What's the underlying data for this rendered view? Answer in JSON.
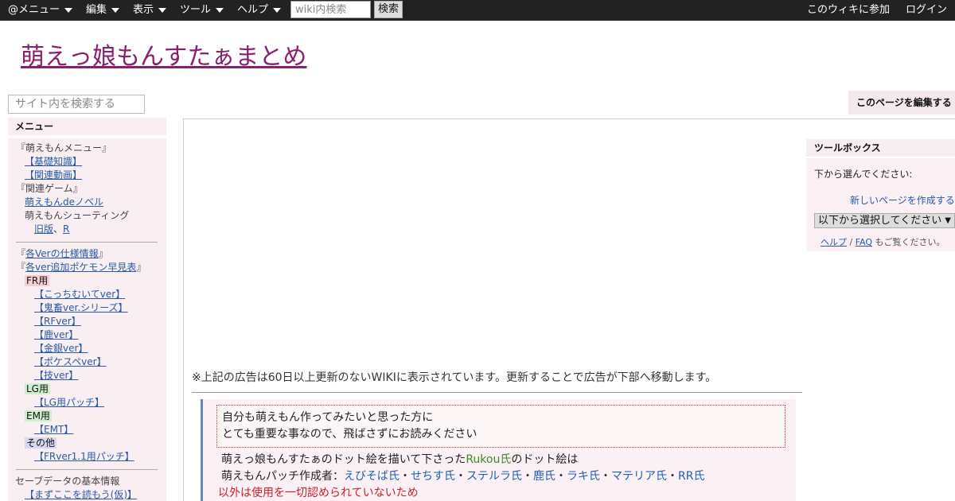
{
  "topbar": {
    "menus": [
      {
        "label": "@メニュー"
      },
      {
        "label": "編集"
      },
      {
        "label": "表示"
      },
      {
        "label": "ツール"
      },
      {
        "label": "ヘルプ"
      }
    ],
    "search_placeholder": "wiki内検索",
    "search_button": "検索",
    "join": "このウィキに参加",
    "login": "ログイン"
  },
  "site": {
    "title": "萌えっ娘もんすたぁまとめ",
    "search_placeholder": "サイト内を検索する",
    "edit_button": "このページを編集する"
  },
  "sidebar": {
    "heading": "メニュー",
    "items": [
      {
        "text": "『萌えもんメニュー』"
      },
      {
        "text": "【基礎知識】"
      },
      {
        "text": "【関連動画】"
      },
      {
        "text": "『関連ゲーム』"
      },
      {
        "text": "萌えもんdeノベル"
      },
      {
        "text": "萌えもんシューティング"
      },
      {
        "text": "旧版"
      },
      {
        "text": "、"
      },
      {
        "text": "R"
      },
      {
        "text": "『"
      },
      {
        "text": "各Verの仕様情報"
      },
      {
        "text": "』"
      },
      {
        "text": "『"
      },
      {
        "text": "各ver追加ポケモン早見表"
      },
      {
        "text": "』"
      },
      {
        "text": "FR用"
      },
      {
        "text": "【こっちむいてver】"
      },
      {
        "text": "【鬼畜ver.シリーズ】"
      },
      {
        "text": "【RFver】"
      },
      {
        "text": "【鹿ver】"
      },
      {
        "text": "【金銀ver】"
      },
      {
        "text": "【ポケスペver】"
      },
      {
        "text": "【技ver】"
      },
      {
        "text": "LG用"
      },
      {
        "text": "【LG用パッチ】"
      },
      {
        "text": "EM用"
      },
      {
        "text": "【EMT】"
      },
      {
        "text": "その他"
      },
      {
        "text": "【FRver1.1用パッチ】"
      },
      {
        "text": "セーブデータの基本情報"
      },
      {
        "text": "【まずここを読もう(仮)】"
      }
    ]
  },
  "toolbox": {
    "heading": "ツールボックス",
    "label": "下から選んでください:",
    "new_page": "新しいページを作成する",
    "select_value": "以下から選択してください",
    "help_link": "ヘルプ",
    "sep": " / ",
    "faq_link": "FAQ",
    "help_suffix": " もご覧ください。"
  },
  "main": {
    "ad_notice": "※上記の広告は60日以上更新のないWIKIに表示されています。更新することで広告が下部へ移動します。",
    "notice_line1": "自分も萌えもん作ってみたいと思った方に",
    "notice_line2": "とても重要な事なので、飛ばさずにお読みください",
    "line1_pre": "萌えっ娘もんすたぁのドット絵を描いて下さった",
    "line1_name": "Rukou氏",
    "line1_post": "のドット絵は",
    "line2_pre": "萌えもんパッチ作成者：",
    "authors": [
      "えびそば氏",
      "せちす氏",
      "ステルラ氏",
      "鹿氏",
      "ラキ氏",
      "マテリア氏",
      "RR氏"
    ],
    "dot": "・",
    "line3": "以外は使用を一切認められていないため"
  },
  "colors": {
    "topbar_bg": "#222222",
    "title": "#8b1f6c",
    "link": "#2a5aa8",
    "sidebar_bg": "#f9eef1"
  }
}
